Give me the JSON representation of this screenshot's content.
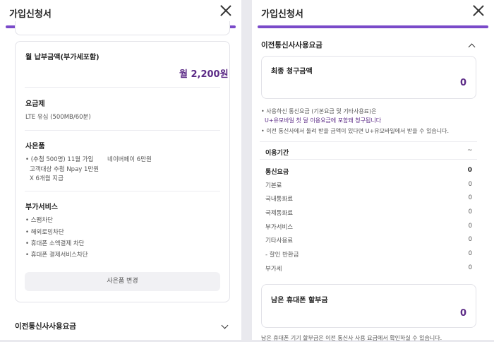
{
  "left": {
    "header_title": "가입신청서",
    "monthly": {
      "label": "월 납부금액(부가세포함)",
      "amount": "월 2,200원"
    },
    "plan": {
      "label": "요금제",
      "value": "LTE 유심 (500MB/60분)"
    },
    "gift": {
      "label": "사은품",
      "line1": "• (추첨 500명) 11월 가입",
      "line1_right": "네이버페이 6만원",
      "line2": "고객대상 추첨 Npay 1만원",
      "line3": "X 6개월 지급"
    },
    "addon": {
      "label": "부가서비스",
      "items": [
        "• 스팸차단",
        "• 해외로밍차단",
        "• 휴대폰 소액결제 차단",
        "• 휴대폰 결제서비스차단"
      ]
    },
    "change_gift_button": "사은품 변경",
    "prev_carrier_section": "이전통신사사용요금"
  },
  "right": {
    "header_title": "가입신청서",
    "section_title": "이전통신사사용요금",
    "final": {
      "label": "최종 청구금액",
      "value": "0"
    },
    "notes": {
      "n1": "• 사용하신 통신요금 (기본요금 및 기타사용료)은",
      "n1b": "U+유모바일 첫 달 이용요금에 포함돼 청구됩니다",
      "n2": "• 이전 통신사에서 돌려 받을 금액이 있다면 U+유모바일에서 받을 수 있습니다."
    },
    "period": {
      "label": "이용기간",
      "value": "~"
    },
    "rows": [
      {
        "k": "통신요금",
        "v": "0"
      },
      {
        "k": "기본료",
        "v": "0"
      },
      {
        "k": "국내통화료",
        "v": "0"
      },
      {
        "k": "국제통화료",
        "v": "0"
      },
      {
        "k": "부가서비스",
        "v": "0"
      },
      {
        "k": "기타사용료",
        "v": "0"
      },
      {
        "k": "- 할인 반환금",
        "v": "0"
      },
      {
        "k": "부가세",
        "v": "0"
      }
    ],
    "remaining": {
      "label": "남은 휴대폰 할부금",
      "value": "0"
    },
    "bottom_note": "남은 휴대폰 기기 할부금은 이전 통신사 사용 요금에서 확인하실 수 있습니다."
  },
  "colors": {
    "accent": "#7a4ac9",
    "amount": "#5b2a86"
  }
}
